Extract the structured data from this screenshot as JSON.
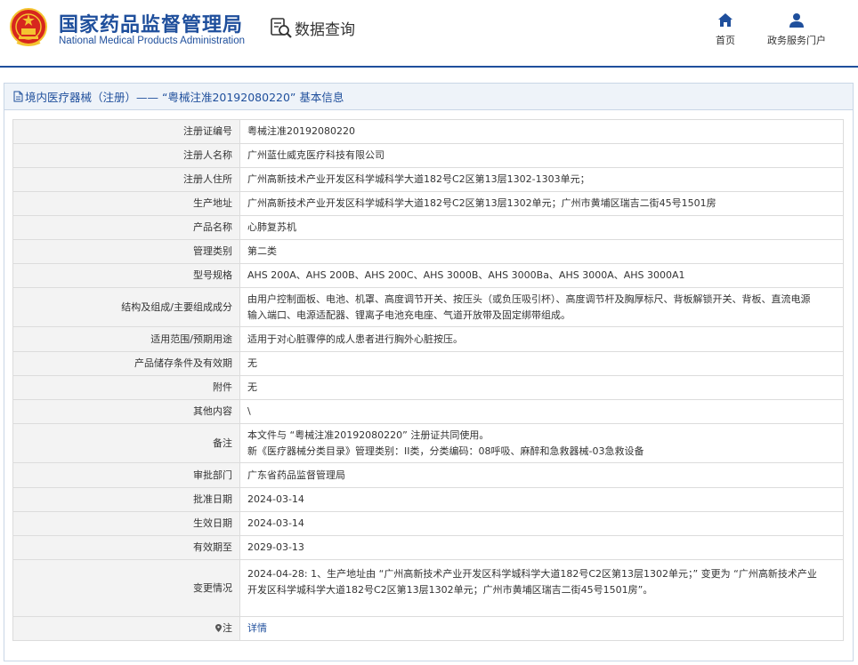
{
  "header": {
    "title_cn": "国家药品监督管理局",
    "title_en": "National Medical Products Administration",
    "query_label": "数据查询",
    "nav": [
      {
        "label": "首页",
        "icon": "home-icon"
      },
      {
        "label": "政务服务门户",
        "icon": "user-icon"
      }
    ]
  },
  "panel": {
    "title": "境内医疗器械（注册）—— “粤械注准20192080220” 基本信息"
  },
  "records": [
    {
      "label": "注册证编号",
      "value": "粤械注准20192080220"
    },
    {
      "label": "注册人名称",
      "value": "广州蓝仕威克医疗科技有限公司"
    },
    {
      "label": "注册人住所",
      "value": "广州高新技术产业开发区科学城科学大道182号C2区第13层1302-1303单元；"
    },
    {
      "label": "生产地址",
      "value": "广州高新技术产业开发区科学城科学大道182号C2区第13层1302单元；广州市黄埔区瑞吉二街45号1501房"
    },
    {
      "label": "产品名称",
      "value": "心肺复苏机"
    },
    {
      "label": "管理类别",
      "value": "第二类"
    },
    {
      "label": "型号规格",
      "value": "AHS 200A、AHS 200B、AHS 200C、AHS 3000B、AHS 3000Ba、AHS 3000A、AHS 3000A1"
    },
    {
      "label": "结构及组成/主要组成成分",
      "lines": [
        "由用户控制面板、电池、机罩、高度调节开关、按压头（或负压吸引杯）、高度调节杆及胸厚标尺、背板解锁开关、背板、直流电源",
        "输入端口、电源适配器、锂离子电池充电座、气道开放带及固定绑带组成。"
      ]
    },
    {
      "label": "适用范围/预期用途",
      "value": "适用于对心脏骤停的成人患者进行胸外心脏按压。"
    },
    {
      "label": "产品储存条件及有效期",
      "value": "无"
    },
    {
      "label": "附件",
      "value": "无"
    },
    {
      "label": "其他内容",
      "value": "\\"
    },
    {
      "label": "备注",
      "lines": [
        "本文件与 “粤械注准20192080220” 注册证共同使用。",
        "新《医疗器械分类目录》管理类别：II类，分类编码：08呼吸、麻醉和急救器械-03急救设备"
      ]
    },
    {
      "label": "审批部门",
      "value": "广东省药品监督管理局"
    },
    {
      "label": "批准日期",
      "value": "2024-03-14"
    },
    {
      "label": "生效日期",
      "value": "2024-03-14"
    },
    {
      "label": "有效期至",
      "value": "2029-03-13"
    },
    {
      "label": "变更情况",
      "lines": [
        "2024-04-28: 1、生产地址由 “广州高新技术产业开发区科学城科学大道182号C2区第13层1302单元；” 变更为 “广州高新技术产业",
        "开发区科学城科学大道182号C2区第13层1302单元；广州市黄埔区瑞吉二街45号1501房”。"
      ]
    },
    {
      "label": "注",
      "value": "详情",
      "link": true
    }
  ],
  "colors": {
    "brand_blue": "#1f4f9c",
    "emblem_red": "#d7261e",
    "emblem_gold": "#f4c430"
  }
}
